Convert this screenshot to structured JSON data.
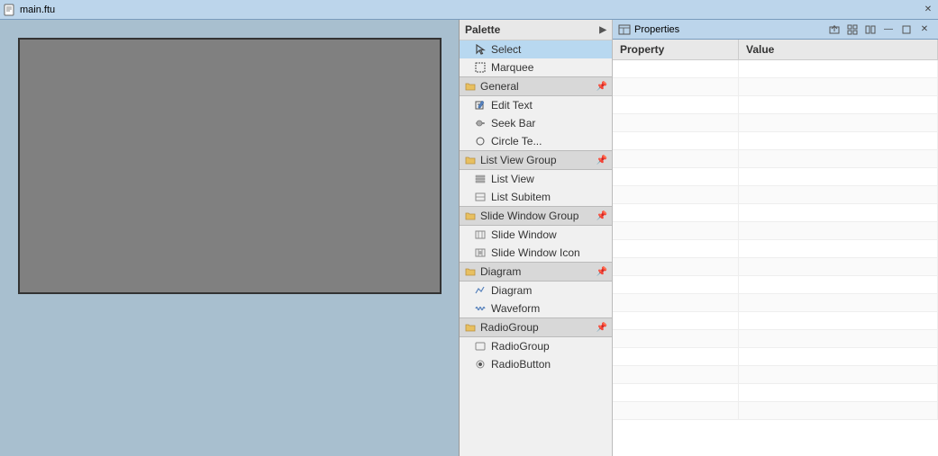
{
  "titleBar": {
    "label": "main.ftu",
    "closeSymbol": "✕"
  },
  "palette": {
    "header": "Palette",
    "headerArrow": "▶",
    "selectLabel": "Select",
    "marqueeLabel": "Marquee",
    "groups": [
      {
        "label": "General",
        "items": [
          {
            "label": "Edit Text",
            "icon": "edit"
          },
          {
            "label": "Seek Bar",
            "icon": "seekbar"
          },
          {
            "label": "Circle Te...",
            "icon": "circle"
          }
        ]
      },
      {
        "label": "List View Group",
        "items": [
          {
            "label": "List View",
            "icon": "listview"
          },
          {
            "label": "List Subitem",
            "icon": "listsubitem"
          }
        ]
      },
      {
        "label": "Slide Window Group",
        "items": [
          {
            "label": "Slide Window",
            "icon": "slidewindow"
          },
          {
            "label": "Slide Window Icon",
            "icon": "slidewindowicon"
          }
        ]
      },
      {
        "label": "Diagram",
        "items": [
          {
            "label": "Diagram",
            "icon": "diagram"
          },
          {
            "label": "Waveform",
            "icon": "waveform"
          }
        ]
      },
      {
        "label": "RadioGroup",
        "items": [
          {
            "label": "RadioGroup",
            "icon": "radiogroup"
          },
          {
            "label": "RadioButton",
            "icon": "radiobutton"
          }
        ]
      }
    ]
  },
  "properties": {
    "panelTitle": "Properties",
    "toolbarButtons": [
      "export",
      "grid",
      "columns",
      "minimize",
      "restore",
      "close"
    ],
    "columns": [
      "Property",
      "Value"
    ],
    "rows": []
  }
}
